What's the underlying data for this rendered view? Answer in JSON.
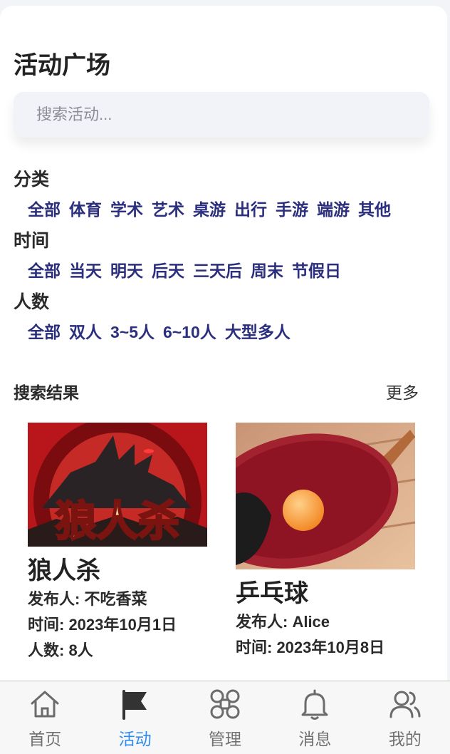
{
  "page": {
    "title": "活动广场"
  },
  "search": {
    "placeholder": "搜索活动..."
  },
  "filters": {
    "category": {
      "title": "分类",
      "options": [
        "全部",
        "体育",
        "学术",
        "艺术",
        "桌游",
        "出行",
        "手游",
        "端游",
        "其他"
      ]
    },
    "time": {
      "title": "时间",
      "options": [
        "全部",
        "当天",
        "明天",
        "后天",
        "三天后",
        "周末",
        "节假日"
      ]
    },
    "people": {
      "title": "人数",
      "options": [
        "全部",
        "双人",
        "3~5人",
        "6~10人",
        "大型多人"
      ]
    }
  },
  "results": {
    "title": "搜索结果",
    "more": "更多",
    "items": [
      {
        "title": "狼人杀",
        "publisher": "发布人: 不吃香菜",
        "time": "时间: 2023年10月1日",
        "people": "人数: 8人",
        "image_text": "狼人杀"
      },
      {
        "title": "乒乓球",
        "publisher": "发布人: Alice",
        "time": "时间: 2023年10月8日"
      }
    ]
  },
  "tabbar": {
    "active": "活动",
    "items": [
      {
        "label": "首页",
        "icon": "home-icon"
      },
      {
        "label": "活动",
        "icon": "flag-icon"
      },
      {
        "label": "管理",
        "icon": "grid-icon"
      },
      {
        "label": "消息",
        "icon": "bell-icon"
      },
      {
        "label": "我的",
        "icon": "user-icon"
      }
    ]
  },
  "colors": {
    "accent": "#2d8cf0",
    "filter_option": "#2b2f7e",
    "background": "#f3f4f8"
  }
}
